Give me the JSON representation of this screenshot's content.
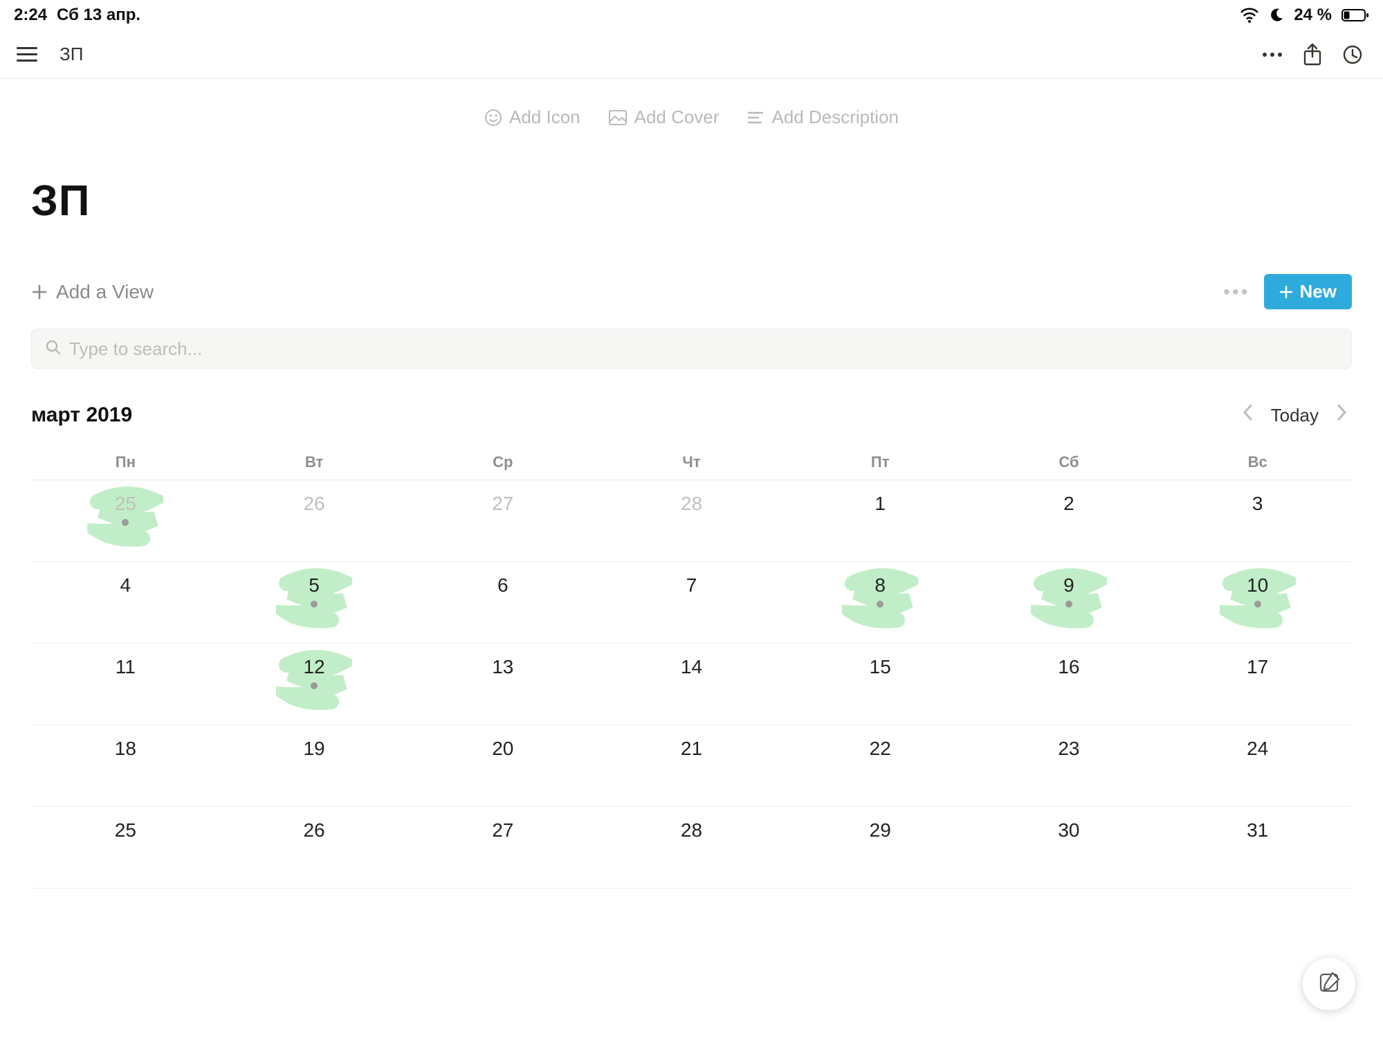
{
  "status": {
    "time": "2:24",
    "date": "Сб 13 апр.",
    "battery_pct": "24 %"
  },
  "nav": {
    "breadcrumb": "ЗП"
  },
  "header": {
    "add_icon": "Add Icon",
    "add_cover": "Add Cover",
    "add_description": "Add Description",
    "title": "ЗП"
  },
  "views": {
    "add_view": "Add a View",
    "new_label": "New"
  },
  "search": {
    "placeholder": "Type to search..."
  },
  "calendar": {
    "month_label": "март 2019",
    "today_label": "Today",
    "weekdays": [
      "Пн",
      "Вт",
      "Ср",
      "Чт",
      "Пт",
      "Сб",
      "Вс"
    ],
    "weeks": [
      [
        {
          "n": "25",
          "other": true,
          "hl": true,
          "dot": true
        },
        {
          "n": "26",
          "other": true
        },
        {
          "n": "27",
          "other": true
        },
        {
          "n": "28",
          "other": true
        },
        {
          "n": "1"
        },
        {
          "n": "2"
        },
        {
          "n": "3"
        }
      ],
      [
        {
          "n": "4"
        },
        {
          "n": "5",
          "hl": true,
          "dot": true
        },
        {
          "n": "6"
        },
        {
          "n": "7"
        },
        {
          "n": "8",
          "hl": true,
          "dot": true
        },
        {
          "n": "9",
          "hl": true,
          "dot": true
        },
        {
          "n": "10",
          "hl": true,
          "dot": true
        }
      ],
      [
        {
          "n": "11"
        },
        {
          "n": "12",
          "hl": true,
          "dot": true
        },
        {
          "n": "13"
        },
        {
          "n": "14"
        },
        {
          "n": "15"
        },
        {
          "n": "16"
        },
        {
          "n": "17"
        }
      ],
      [
        {
          "n": "18"
        },
        {
          "n": "19"
        },
        {
          "n": "20"
        },
        {
          "n": "21"
        },
        {
          "n": "22"
        },
        {
          "n": "23"
        },
        {
          "n": "24"
        }
      ],
      [
        {
          "n": "25"
        },
        {
          "n": "26"
        },
        {
          "n": "27"
        },
        {
          "n": "28"
        },
        {
          "n": "29"
        },
        {
          "n": "30"
        },
        {
          "n": "31"
        }
      ]
    ]
  }
}
